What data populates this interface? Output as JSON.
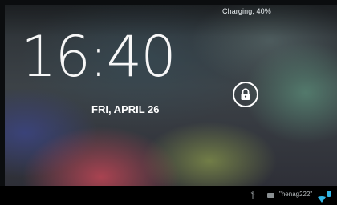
{
  "status": {
    "charging_text": "Charging, 40%"
  },
  "lockscreen": {
    "time": "16:40",
    "date": "FRI, APRIL 26",
    "lock_icon": "padlock-icon"
  },
  "navbar": {
    "network_name": "\"henag222\"",
    "icons": [
      "usb-icon",
      "battery-small-icon",
      "wifi-icon",
      "battery-icon"
    ]
  },
  "colors": {
    "accent": "#33b5e5",
    "text": "#ffffff"
  }
}
